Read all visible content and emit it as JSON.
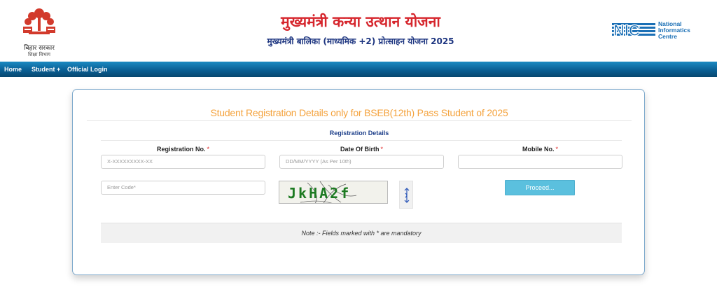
{
  "header": {
    "gov_name": "बिहार सरकार",
    "dept_name": "शिक्षा विभाग",
    "title": "मुख्यमंत्री कन्या उत्थान योजना",
    "subtitle": "मुख्यमंत्री बालिका (माध्यमिक +2) प्रोत्साहन योजना 2025",
    "nic_abbr": "NIC",
    "nic_line1": "National",
    "nic_line2": "Informatics",
    "nic_line3": "Centre"
  },
  "nav": {
    "home": "Home",
    "student": "Student +",
    "official_login": "Official Login"
  },
  "form": {
    "heading": "Student Registration Details only for BSEB(12th) Pass Student of 2025",
    "section_title": "Registration Details",
    "registration_label": "Registration No.",
    "dob_label": "Date Of Birth",
    "mobile_label": "Mobile No.",
    "required_mark": "*",
    "registration_placeholder": "X-XXXXXXXXX-XX",
    "dob_placeholder": "DD/MM/YYYY (As Per 10th)",
    "mobile_placeholder": "",
    "captcha_placeholder": "Enter Code*",
    "captcha_text": "JkHA2f",
    "proceed_label": "Proceed...",
    "note": "Note :- Fields marked with * are mandatory"
  },
  "colors": {
    "title_red": "#d6262d",
    "subtitle_blue": "#1d3580",
    "heading_orange": "#f4a23c",
    "nav_blue": "#0a5f94",
    "proceed_button": "#5bc0de",
    "captcha_green": "#1d7a22"
  }
}
